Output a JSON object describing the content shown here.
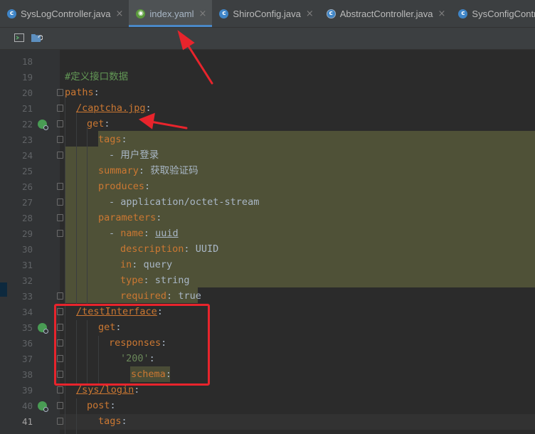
{
  "tabs": [
    {
      "label": "SysLogController.java",
      "icon": "java-class-icon",
      "active": false
    },
    {
      "label": "index.yaml",
      "icon": "yaml-file-icon",
      "active": true
    },
    {
      "label": "ShiroConfig.java",
      "icon": "java-class-icon",
      "active": false
    },
    {
      "label": "AbstractController.java",
      "icon": "java-abstract-class-icon",
      "active": false
    },
    {
      "label": "SysConfigController.java",
      "icon": "java-class-icon",
      "active": false
    }
  ],
  "toolbar": {
    "buttons": [
      {
        "icon": "terminal-icon"
      },
      {
        "icon": "folder-sync-icon"
      }
    ]
  },
  "editor": {
    "lines": [
      {
        "num": "18",
        "text": ""
      },
      {
        "num": "19",
        "text": "#定义接口数据"
      },
      {
        "num": "20",
        "text": "paths:"
      },
      {
        "num": "21",
        "text": "/captcha.jpg:"
      },
      {
        "num": "22",
        "text": "get:"
      },
      {
        "num": "23",
        "text": "tags:"
      },
      {
        "num": "24",
        "text": "- 用户登录"
      },
      {
        "num": "25",
        "text": "summary: 获取验证码"
      },
      {
        "num": "26",
        "text": "produces:"
      },
      {
        "num": "27",
        "text": "- application/octet-stream"
      },
      {
        "num": "28",
        "text": "parameters:"
      },
      {
        "num": "29",
        "text": "- name: uuid"
      },
      {
        "num": "30",
        "text": "description: UUID"
      },
      {
        "num": "31",
        "text": "in: query"
      },
      {
        "num": "32",
        "text": "type: string"
      },
      {
        "num": "33",
        "text": "required: true"
      },
      {
        "num": "34",
        "text": "/testInterface:"
      },
      {
        "num": "35",
        "text": "get:"
      },
      {
        "num": "36",
        "text": "responses:"
      },
      {
        "num": "37",
        "text": "'200':"
      },
      {
        "num": "38",
        "text": "schema:"
      },
      {
        "num": "39",
        "text": "/sys/login:"
      },
      {
        "num": "40",
        "text": "post:"
      },
      {
        "num": "41",
        "text": "tags:"
      }
    ],
    "tokens": {
      "comment": "#定义接口数据",
      "paths_key": "paths",
      "captcha_key": "/captcha.jpg",
      "get1": "get",
      "tags1": "tags",
      "tag_value": "- 用户登录",
      "summary_key": "summary",
      "summary_val": "获取验证码",
      "produces_key": "produces",
      "produces_val": "- application/octet-stream",
      "parameters_key": "parameters",
      "name_dash": "- ",
      "name_key": "name",
      "name_val": "uuid",
      "description_key": "description",
      "description_val": "UUID",
      "in_key": "in",
      "in_val": "query",
      "type_key": "type",
      "type_val": "string",
      "required_key": "required",
      "required_val": "true",
      "test_key": "/testInterface",
      "get2": "get",
      "responses_key": "responses",
      "code_200": "'200'",
      "schema_key": "schema",
      "login_key": "/sys/login",
      "post_key": "post",
      "tags2": "tags",
      "colon": ":"
    }
  },
  "colors": {
    "annotation": "#e8242c",
    "highlight_block": "#4f5137",
    "yaml_key": "#cc7832",
    "comment": "#629755",
    "string": "#6a8759"
  }
}
